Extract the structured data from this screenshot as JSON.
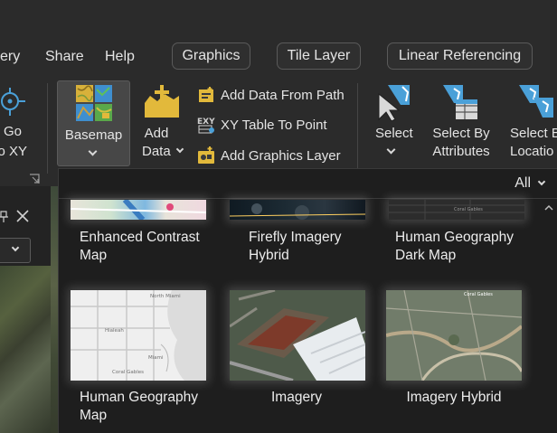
{
  "menu": {
    "partial_left": "ery",
    "share": "Share",
    "help": "Help",
    "contextual_tabs": [
      "Graphics",
      "Tile Layer",
      "Linear Referencing"
    ]
  },
  "ribbon": {
    "goto_xy": {
      "line1": "Go",
      "line2": "To XY"
    },
    "basemap": {
      "label": "Basemap"
    },
    "add_data": {
      "line1": "Add",
      "line2": "Data"
    },
    "small_commands": [
      "Add Data From Path",
      "XY Table To Point",
      "Add Graphics Layer"
    ],
    "select": {
      "label": "Select"
    },
    "select_by_attributes": {
      "line1": "Select By",
      "line2": "Attributes"
    },
    "select_by_location": {
      "line1": "Select B",
      "line2": "Locatio"
    }
  },
  "gallery": {
    "filter": "All",
    "items": [
      {
        "line1": "Enhanced Contrast",
        "line2": "Map"
      },
      {
        "line1": "Firefly Imagery",
        "line2": "Hybrid"
      },
      {
        "line1": "Human Geography",
        "line2": "Dark Map"
      },
      {
        "line1": "Human Geography",
        "line2": "Map"
      },
      {
        "line1": "Imagery",
        "line2": ""
      },
      {
        "line1": "Imagery Hybrid",
        "line2": ""
      }
    ],
    "map_text": {
      "coral_gables": "Coral Gables",
      "north_miami": "North Miami",
      "hialeah": "Hialeah",
      "miami": "Miami"
    }
  },
  "colors": {
    "background": "#1f1f1f",
    "ribbon": "#2b2b2b",
    "selected_button": "#474747",
    "icon_blue": "#4aa0d8",
    "icon_yellow": "#e2b93b"
  }
}
